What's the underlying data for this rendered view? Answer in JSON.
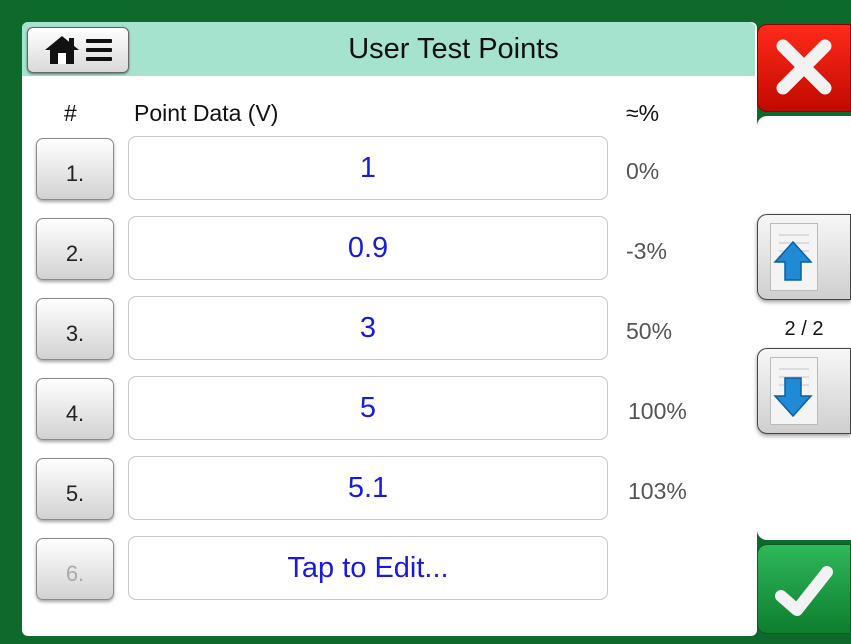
{
  "header": {
    "title": "User Test Points"
  },
  "columns": {
    "num": "#",
    "data": "Point Data (V)",
    "pct": "≈%"
  },
  "rows": [
    {
      "label": "1.",
      "value": "1",
      "pct": "0%",
      "enabled": true
    },
    {
      "label": "2.",
      "value": "0.9",
      "pct": "-3%",
      "enabled": true
    },
    {
      "label": "3.",
      "value": "3",
      "pct": "50%",
      "enabled": true
    },
    {
      "label": "4.",
      "value": "5",
      "pct": "100%",
      "enabled": true
    },
    {
      "label": "5.",
      "value": "5.1",
      "pct": "103%",
      "enabled": true
    },
    {
      "label": "6.",
      "value": "Tap to Edit...",
      "pct": "",
      "enabled": false
    }
  ],
  "pager": {
    "indicator": "2 / 2"
  },
  "icons": {
    "home": "home-icon",
    "menu": "menu-icon",
    "close": "close-icon",
    "up": "arrow-up-icon",
    "down": "arrow-down-icon",
    "ok": "checkmark-icon"
  },
  "colors": {
    "background": "#0e6a2c",
    "titlebar": "#a6e3cf",
    "value_text": "#1a1adf",
    "close": "#e01a0c",
    "ok": "#1f9a44"
  }
}
